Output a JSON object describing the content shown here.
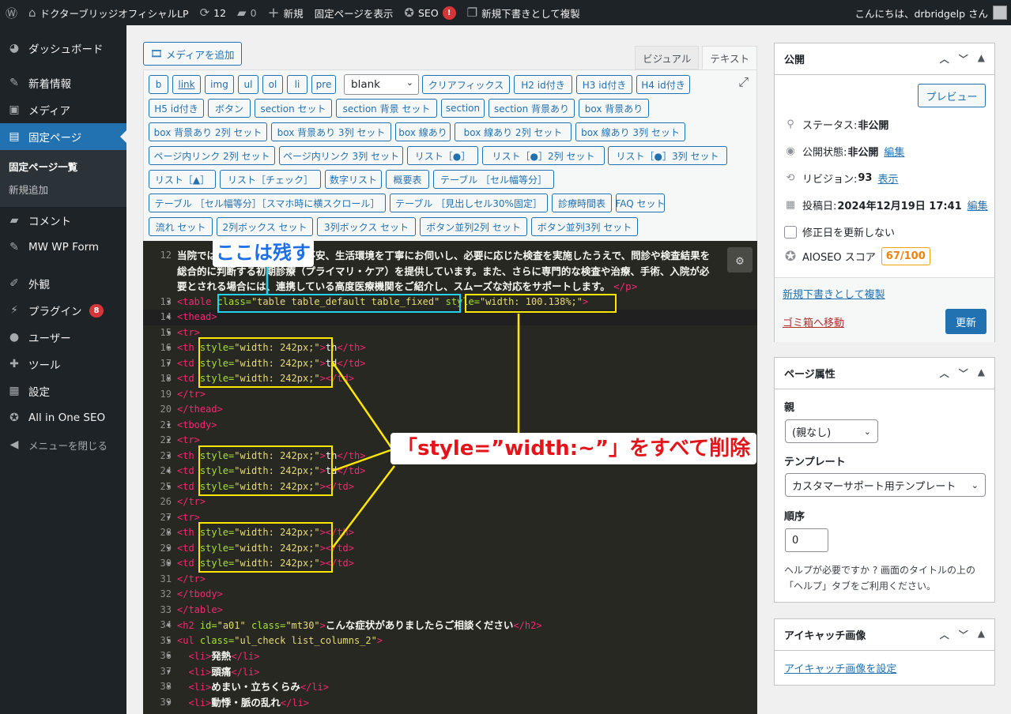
{
  "admin_bar": {
    "site_name": "ドクターブリッジオフィシャルLP",
    "updates_count": "12",
    "comments_count": "0",
    "new_label": "新規",
    "view_page": "固定ページを表示",
    "seo_label": "SEO",
    "seo_alert": "!",
    "duplicate_draft": "新規下書きとして複製",
    "greeting": "こんにちは、drbridgelp さん"
  },
  "sidebar": {
    "items": [
      {
        "label": "ダッシュボード",
        "icon": "dashboard-icon"
      },
      {
        "label": "新着情報",
        "icon": "pin-icon"
      },
      {
        "label": "メディア",
        "icon": "media-icon"
      },
      {
        "label": "固定ページ",
        "icon": "page-icon"
      },
      {
        "label": "コメント",
        "icon": "comment-icon"
      },
      {
        "label": "MW WP Form",
        "icon": "pin-icon"
      },
      {
        "label": "外観",
        "icon": "brush-icon"
      },
      {
        "label": "プラグイン",
        "icon": "plugin-icon",
        "badge": "8"
      },
      {
        "label": "ユーザー",
        "icon": "user-icon"
      },
      {
        "label": "ツール",
        "icon": "wrench-icon"
      },
      {
        "label": "設定",
        "icon": "settings-icon"
      },
      {
        "label": "All in One SEO",
        "icon": "aioseo-icon"
      }
    ],
    "submenu": [
      "固定ページ一覧",
      "新規追加"
    ],
    "collapse": "メニューを閉じる"
  },
  "editor": {
    "add_media": "メディアを追加",
    "tab_visual": "ビジュアル",
    "tab_text": "テキスト",
    "format_select": "blank",
    "quicktags_row1": [
      "b",
      "link",
      "img",
      "ul",
      "ol",
      "li",
      "pre"
    ],
    "quicktags_row1b": [
      "クリアフィックス",
      "H2 id付き",
      "H3 id付き",
      "H4 id付き"
    ],
    "quicktags_row2": [
      "H5 id付き",
      "ボタン",
      "section セット",
      "section 背景 セット",
      "section",
      "section 背景あり",
      "box 背景あり"
    ],
    "quicktags_row3": [
      "box 背景あり 2列 セット",
      "box 背景あり 3列 セット",
      "box 線あり",
      "box 線あり 2列 セット",
      "box 線あり 3列 セット"
    ],
    "quicktags_row4": [
      "ページ内リンク 2列 セット",
      "ページ内リンク 3列 セット",
      "リスト［●］",
      "リスト［●］2列 セット",
      "リスト［●］3列 セット"
    ],
    "quicktags_row5": [
      "リスト［▲］",
      "リスト［チェック］",
      "数字リスト",
      "概要表",
      "テーブル ［セル幅等分］"
    ],
    "quicktags_row6": [
      "テーブル ［セル幅等分］［スマホ時に横スクロール］",
      "テーブル ［見出しセル30%固定］",
      "診療時間表",
      "FAQ セット"
    ],
    "quicktags_row7": [
      "流れ セット",
      "2列ボックス セット",
      "3列ボックス セット",
      "ボタン並列2列 セット",
      "ボタン並列3列 セット"
    ]
  },
  "code": {
    "line12_num": "12",
    "line12_a": "当院では、患者さまの症状や不安、生活環境を丁寧にお伺いし、必要に応じた検査を実施したうえで、問診や検査結果を",
    "line12_b": "総合的に判断する初期診療（プライマリ・ケア）を提供しています。また、さらに専門的な検査や治療、手術、入院が必",
    "line12_c": "要とされる場合には、連携している高度医療機関をご紹介し、スムーズな対応をサポートします。",
    "line12_c_tag": "</p>",
    "lines": [
      {
        "n": "13",
        "html": "<span class='tg'>&lt;table </span><span class='at'>class=</span><span class='st'>\"table table_default table_fixed\"</span> <span class='at'>style=</span><span class='st'>\"width: 100.138%;\"</span><span class='tg'>&gt;</span>"
      },
      {
        "n": "14",
        "html": "<span class='tg'>&lt;thead&gt;</span>"
      },
      {
        "n": "15",
        "html": "<span class='tg'>&lt;tr&gt;</span>"
      },
      {
        "n": "16",
        "html": "<span class='tg'>&lt;th </span><span class='at'>style=</span><span class='st'>\"width: 242px;\"</span><span class='tg'>&gt;</span>th<span class='tg'>&lt;/th&gt;</span>"
      },
      {
        "n": "17",
        "html": "<span class='tg'>&lt;td </span><span class='at'>style=</span><span class='st'>\"width: 242px;\"</span><span class='tg'>&gt;</span>td<span class='tg'>&lt;/td&gt;</span>"
      },
      {
        "n": "18",
        "html": "<span class='tg'>&lt;td </span><span class='at'>style=</span><span class='st'>\"width: 242px;\"</span><span class='tg'>&gt;&lt;/td&gt;</span>"
      },
      {
        "n": "19",
        "html": "<span class='tg'>&lt;/tr&gt;</span>"
      },
      {
        "n": "20",
        "html": "<span class='tg'>&lt;/thead&gt;</span>"
      },
      {
        "n": "21",
        "html": "<span class='tg'>&lt;tbody&gt;</span>"
      },
      {
        "n": "22",
        "html": "<span class='tg'>&lt;tr&gt;</span>"
      },
      {
        "n": "23",
        "html": "<span class='tg'>&lt;th </span><span class='at'>style=</span><span class='st'>\"width: 242px;\"</span><span class='tg'>&gt;</span>th<span class='tg'>&lt;/th&gt;</span>"
      },
      {
        "n": "24",
        "html": "<span class='tg'>&lt;td </span><span class='at'>style=</span><span class='st'>\"width: 242px;\"</span><span class='tg'>&gt;</span>td<span class='tg'>&lt;/td&gt;</span>"
      },
      {
        "n": "25",
        "html": "<span class='tg'>&lt;td </span><span class='at'>style=</span><span class='st'>\"width: 242px;\"</span><span class='tg'>&gt;&lt;/td&gt;</span>"
      },
      {
        "n": "26",
        "html": "<span class='tg'>&lt;/tr&gt;</span>"
      },
      {
        "n": "27",
        "html": "<span class='tg'>&lt;tr&gt;</span>"
      },
      {
        "n": "28",
        "html": "<span class='tg'>&lt;th </span><span class='at'>style=</span><span class='st'>\"width: 242px;\"</span><span class='tg'>&gt;&lt;/th&gt;</span>"
      },
      {
        "n": "29",
        "html": "<span class='tg'>&lt;td </span><span class='at'>style=</span><span class='st'>\"width: 242px;\"</span><span class='tg'>&gt;&lt;/td&gt;</span>"
      },
      {
        "n": "30",
        "html": "<span class='tg'>&lt;td </span><span class='at'>style=</span><span class='st'>\"width: 242px;\"</span><span class='tg'>&gt;&lt;/td&gt;</span>"
      },
      {
        "n": "31",
        "html": "<span class='tg'>&lt;/tr&gt;</span>"
      },
      {
        "n": "32",
        "html": "<span class='tg'>&lt;/tbody&gt;</span>"
      },
      {
        "n": "33",
        "html": "<span class='tg'>&lt;/table&gt;</span>"
      },
      {
        "n": "34",
        "html": "<span class='tg'>&lt;h2 </span><span class='at'>id=</span><span class='st'>\"a01\"</span> <span class='at'>class=</span><span class='st'>\"mt30\"</span><span class='tg'>&gt;</span><span class='jp'>こんな症状がありましたらご相談ください</span><span class='tg'>&lt;/h2&gt;</span>"
      },
      {
        "n": "35",
        "html": "<span class='tg'>&lt;ul </span><span class='at'>class=</span><span class='st'>\"ul_check list_columns_2\"</span><span class='tg'>&gt;</span>"
      },
      {
        "n": "36",
        "html": "  <span class='tg'>&lt;li&gt;</span><span class='jp'>発熱</span><span class='tg'>&lt;/li&gt;</span>"
      },
      {
        "n": "37",
        "html": "  <span class='tg'>&lt;li&gt;</span><span class='jp'>頭痛</span><span class='tg'>&lt;/li&gt;</span>"
      },
      {
        "n": "38",
        "html": "  <span class='tg'>&lt;li&gt;</span><span class='jp'>めまい・立ちくらみ</span><span class='tg'>&lt;/li&gt;</span>"
      },
      {
        "n": "39",
        "html": "  <span class='tg'>&lt;li&gt;</span><span class='jp'>動悸・脈の乱れ</span><span class='tg'>&lt;/li&gt;</span>"
      }
    ]
  },
  "annotations": {
    "keep": "ここは残す",
    "delete_all": "「style=”width:~”」をすべて削除"
  },
  "publish": {
    "title": "公開",
    "preview": "プレビュー",
    "status_label": "ステータス:",
    "status_value": "非公開",
    "visibility_label": "公開状態:",
    "visibility_value": "非公開",
    "edit": "編集",
    "revisions_label": "リビジョン:",
    "revisions_value": "93",
    "show": "表示",
    "date_label": "投稿日:",
    "date_value": "2024年12月19日 17:41",
    "date_edit": "編集",
    "no_update_date": "修正日を更新しない",
    "aioseo_label": "AIOSEO スコア",
    "aioseo_score": "67/100",
    "duplicate": "新規下書きとして複製",
    "trash": "ゴミ箱へ移動",
    "update": "更新"
  },
  "page_attributes": {
    "title": "ページ属性",
    "parent_label": "親",
    "parent_value": "(親なし)",
    "template_label": "テンプレート",
    "template_value": "カスタマーサポート用テンプレート",
    "order_label": "順序",
    "order_value": "0",
    "help": "ヘルプが必要ですか ? 画面のタイトルの上の「ヘルプ」タブをご利用ください。"
  },
  "featured_image": {
    "title": "アイキャッチ画像",
    "set_link": "アイキャッチ画像を設定"
  }
}
